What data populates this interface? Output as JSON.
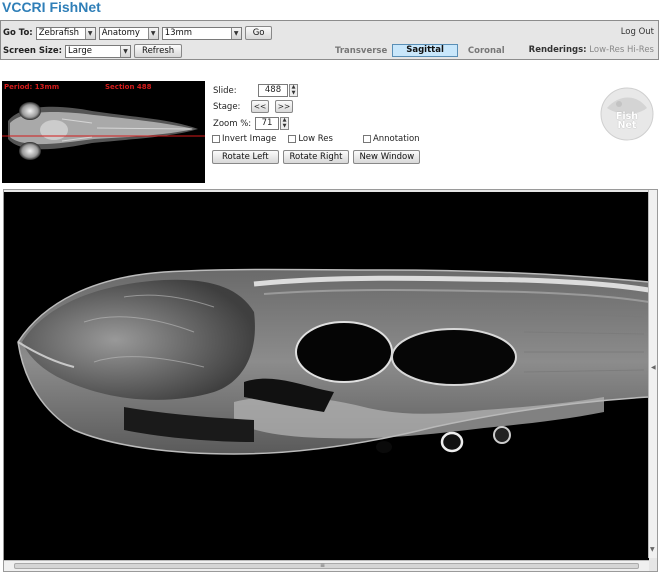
{
  "app": {
    "title": "VCCRI FishNet"
  },
  "toolbar": {
    "goto_label": "Go To:",
    "species": "Zebrafish",
    "category": "Anatomy",
    "period": "13mm",
    "go_label": "Go",
    "logout_label": "Log Out",
    "screen_size_label": "Screen Size:",
    "screen_size": "Large",
    "refresh_label": "Refresh",
    "views": [
      {
        "label": "Transverse",
        "active": false
      },
      {
        "label": "Sagittal",
        "active": true
      },
      {
        "label": "Coronal",
        "active": false
      }
    ],
    "renderings_label": "Renderings:",
    "renderings_options": [
      "Low-Res",
      "Hi-Res"
    ]
  },
  "thumbnail": {
    "period_text": "Period: 13mm",
    "section_text": "Section 488"
  },
  "controls": {
    "slide_label": "Slide:",
    "slide_value": "488",
    "stage_label": "Stage:",
    "stage_prev": "<<",
    "stage_next": ">>",
    "zoom_label": "Zoom %:",
    "zoom_value": "71",
    "invert_label": "Invert Image",
    "lowres_label": "Low Res",
    "annotation_label": "Annotation",
    "rotate_left_label": "Rotate Left",
    "rotate_right_label": "Rotate Right",
    "new_window_label": "New Window"
  },
  "logo": {
    "text": "Fish Net"
  },
  "colors": {
    "brand": "#2f7fb8",
    "active_tab": "#c9e7fb",
    "overlay_red": "#d41a1a"
  },
  "icons": [
    "dropdown-arrow",
    "spinner-arrows",
    "fishnet-logo",
    "scroll-arrows"
  ]
}
